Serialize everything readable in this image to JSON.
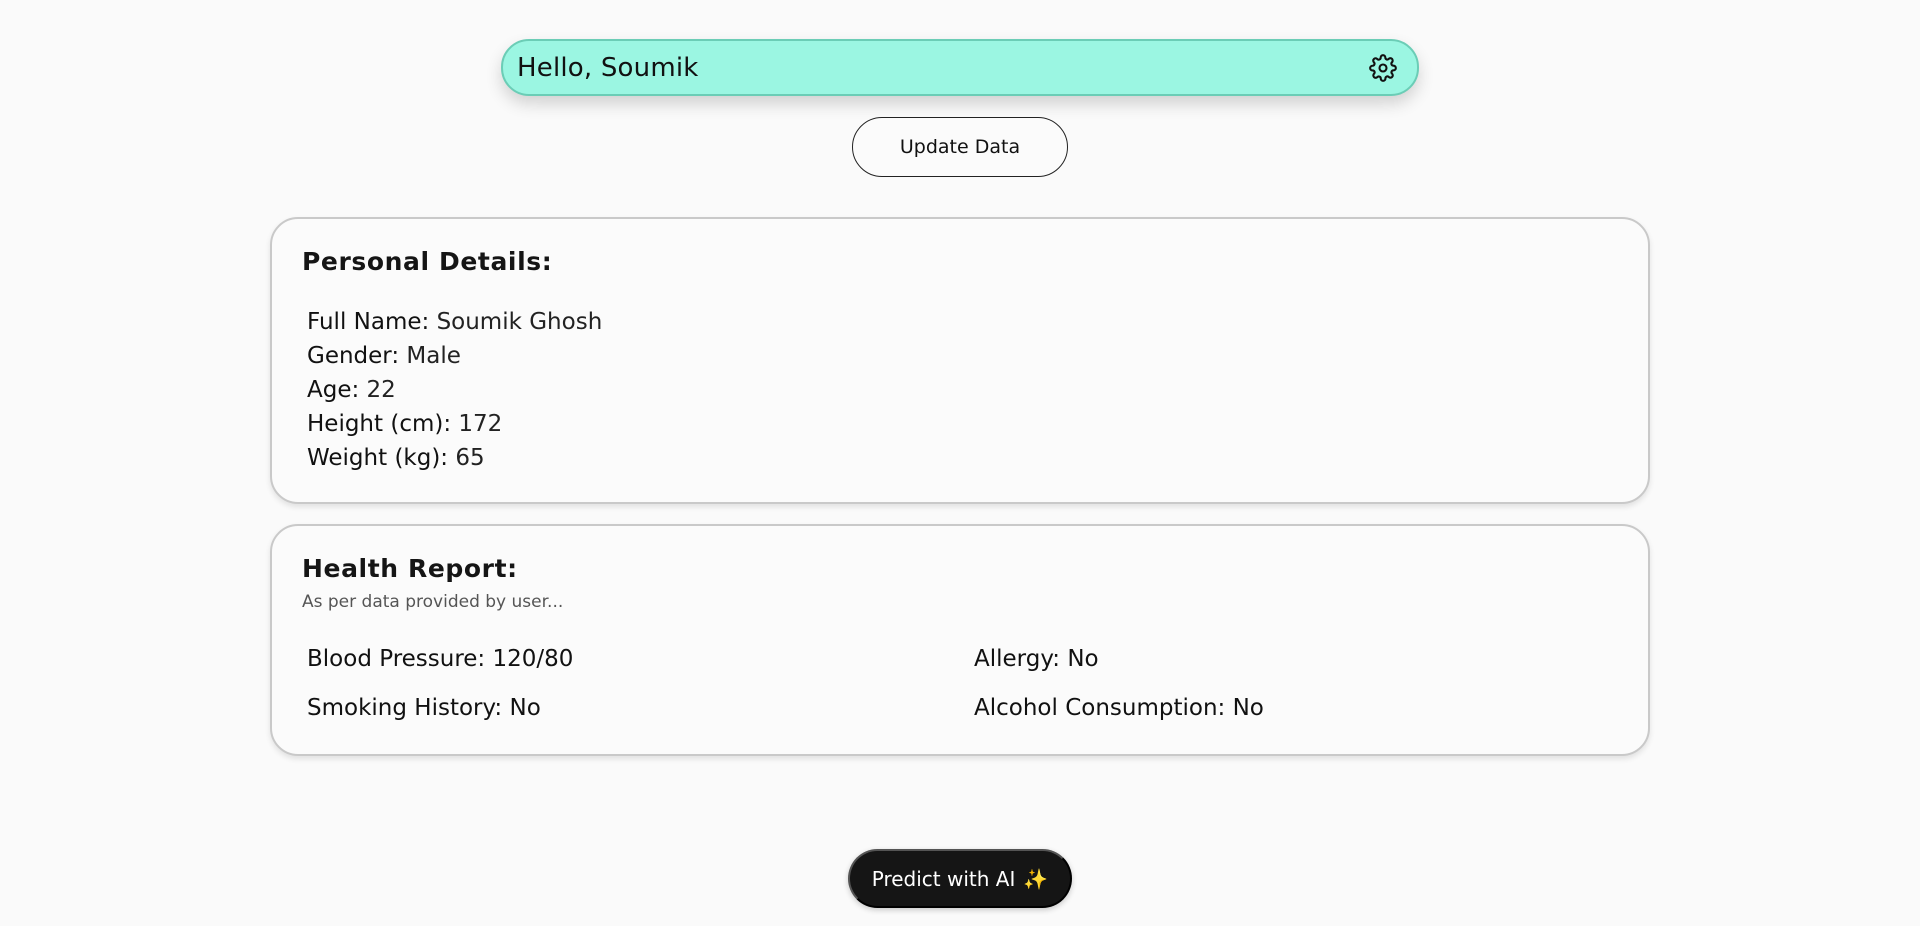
{
  "header": {
    "greeting": "Hello, Soumik",
    "settings_icon": "gear-icon"
  },
  "actions": {
    "update_label": "Update Data",
    "predict_label": "Predict with AI",
    "predict_icon": "sparkles-icon",
    "predict_glyph": "✨"
  },
  "personal": {
    "title": "Personal Details:",
    "fields": [
      {
        "label": "Full Name:",
        "value": "Soumik Ghosh"
      },
      {
        "label": "Gender:",
        "value": "Male"
      },
      {
        "label": "Age:",
        "value": "22"
      },
      {
        "label": "Height (cm):",
        "value": "172"
      },
      {
        "label": "Weight (kg):",
        "value": "65"
      }
    ]
  },
  "health": {
    "title": "Health Report:",
    "subtitle": "As per data provided by user...",
    "items": [
      {
        "label": "Blood Pressure:",
        "value": "120/80"
      },
      {
        "label": "Allergy:",
        "value": "No"
      },
      {
        "label": "Smoking History:",
        "value": "No"
      },
      {
        "label": "Alcohol Consumption:",
        "value": "No"
      }
    ]
  },
  "colors": {
    "greeting_bg": "#9bf6e2",
    "predict_bg": "#151515",
    "page_bg": "#fafafa"
  }
}
